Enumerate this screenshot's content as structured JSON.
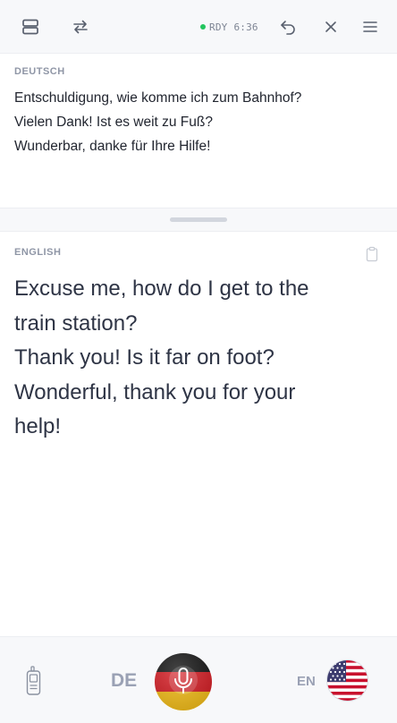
{
  "toolbar": {
    "status_label": "RDY",
    "status_time": "6:36",
    "status_color": "#22c55e",
    "icons": [
      "split-layout-icon",
      "swap-icon",
      "undo-icon",
      "close-icon",
      "menu-icon"
    ]
  },
  "source": {
    "language_label": "DEUTSCH",
    "lines": [
      "Entschuldigung, wie komme ich zum Bahnhof?",
      "Vielen Dank! Ist es weit zu Fuß?",
      "Wunderbar, danke für Ihre Hilfe!"
    ]
  },
  "target": {
    "language_label": "ENGLISH",
    "lines": [
      "Excuse me, how do I get to the",
      "train station?",
      "Thank you! Is it far on foot?",
      "Wonderful, thank you for your",
      "help!"
    ]
  },
  "bottom": {
    "left_language_code": "DE",
    "right_language_code": "EN",
    "icons": [
      "handheld-device-icon",
      "microphone-icon",
      "germany-flag-icon",
      "usa-flag-icon"
    ]
  },
  "colors": {
    "accent_status": "#22c55e",
    "muted_label": "#8f96a6",
    "lang_code": "#9aa1b4"
  }
}
